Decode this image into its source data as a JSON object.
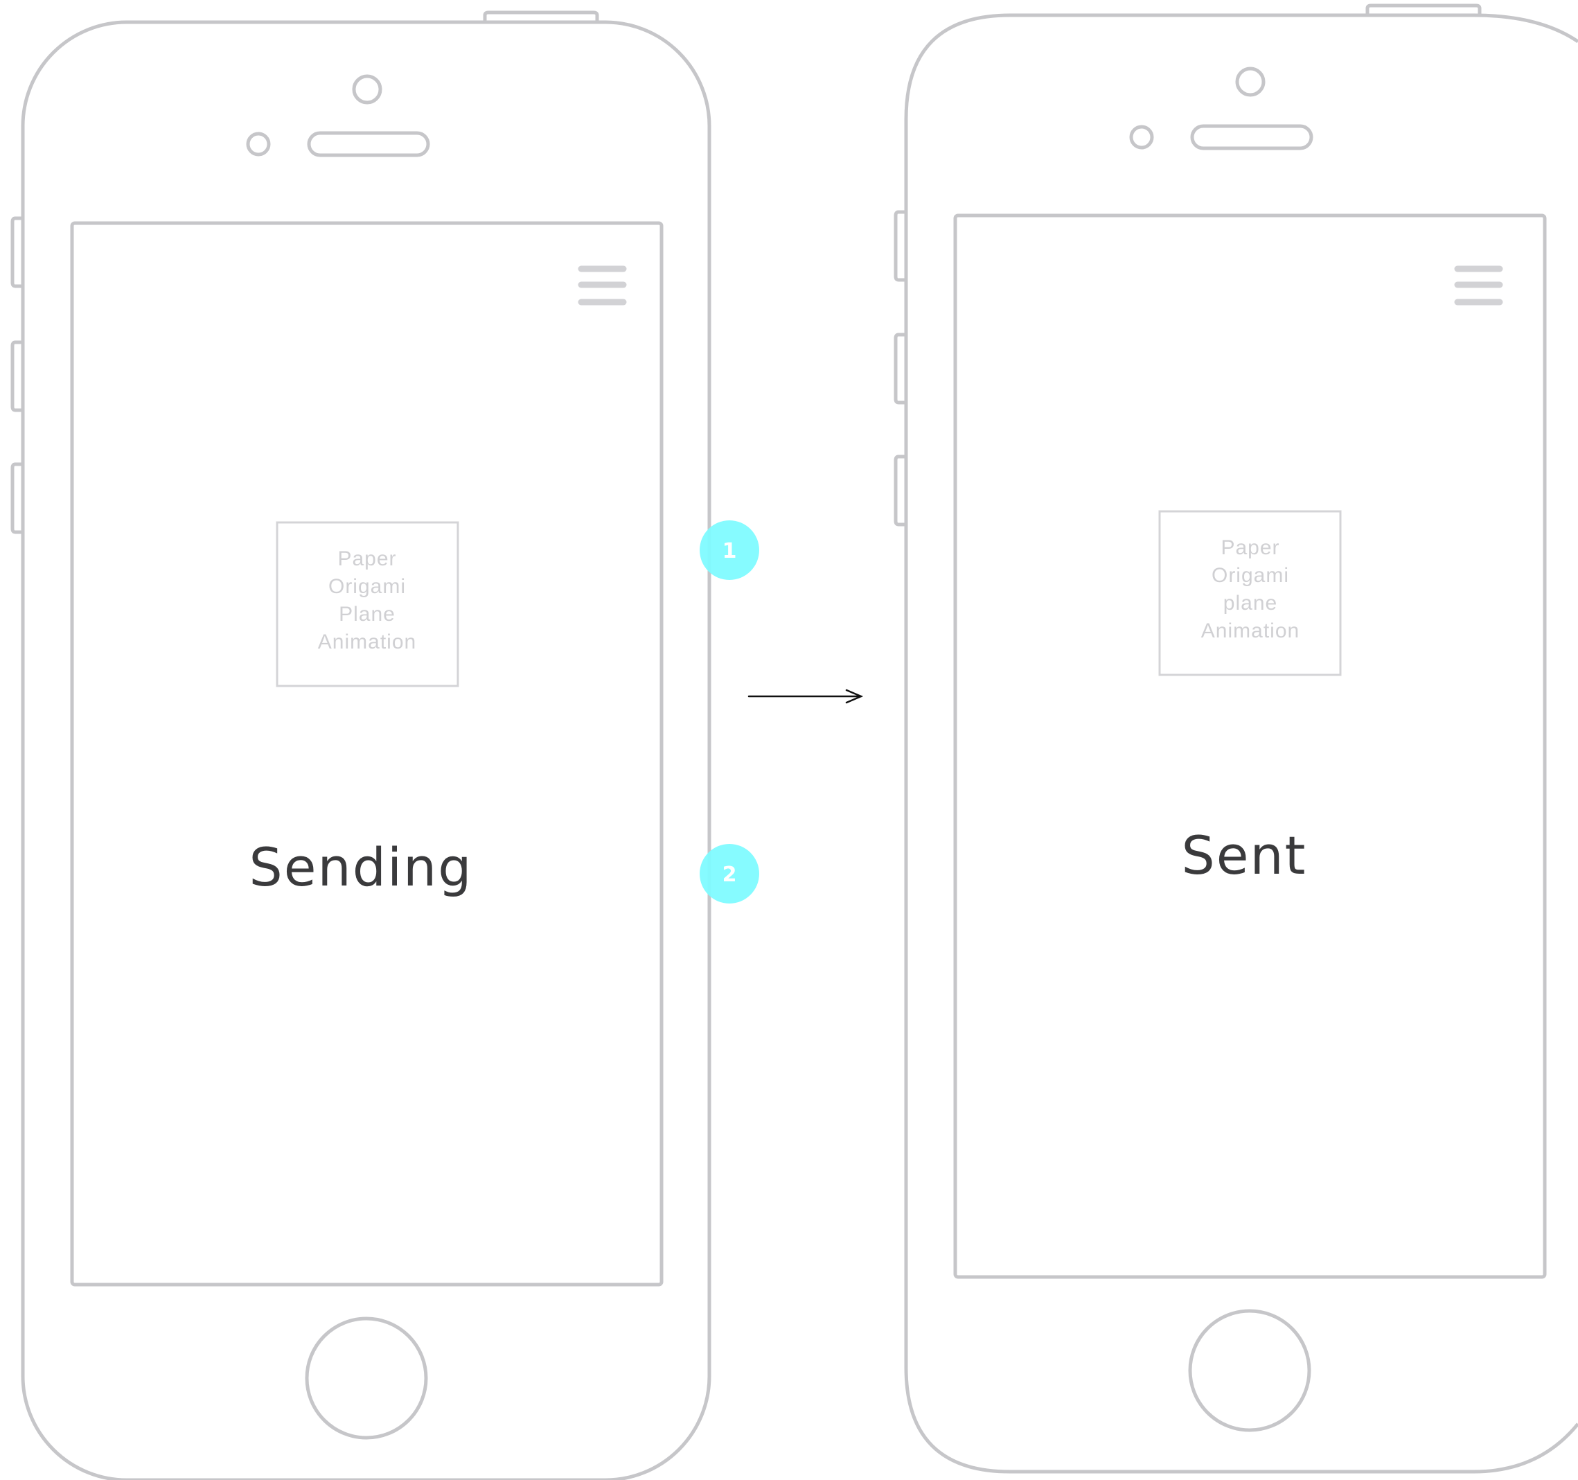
{
  "screens": [
    {
      "id": "sending",
      "placeholder_lines": [
        "Paper",
        "Origami",
        "Plane",
        "Animation"
      ],
      "status": "Sending"
    },
    {
      "id": "sent",
      "placeholder_lines": [
        "Paper",
        "Origami",
        "plane",
        "Animation"
      ],
      "status": "Sent"
    }
  ],
  "annotations": [
    {
      "number": "1"
    },
    {
      "number": "2"
    }
  ],
  "colors": {
    "device_stroke": "#c6c6c9",
    "annotation": "#7ffbff",
    "status_text": "#3a3a3c",
    "placeholder_text": "#d0d0d3",
    "arrow": "#111111"
  },
  "icons": {
    "menu": "hamburger-menu-icon",
    "transition": "arrow-right-icon"
  }
}
